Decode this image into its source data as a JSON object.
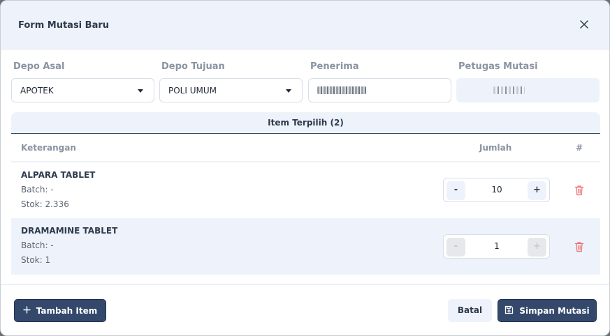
{
  "modal": {
    "title": "Form Mutasi Baru"
  },
  "fields": {
    "depo_asal": {
      "label": "Depo Asal",
      "value": "APOTEK"
    },
    "depo_tujuan": {
      "label": "Depo Tujuan",
      "value": "POLI UMUM"
    },
    "penerima": {
      "label": "Penerima"
    },
    "petugas": {
      "label": "Petugas Mutasi"
    }
  },
  "items": {
    "header": "Item Terpilih (2)",
    "columns": {
      "keterangan": "Keterangan",
      "jumlah": "Jumlah",
      "aksi": "#"
    },
    "rows": [
      {
        "name": "ALPARA TABLET",
        "batch": "Batch: -",
        "stok": "Stok: 2.336",
        "qty": "10"
      },
      {
        "name": "DRAMAMINE TABLET",
        "batch": "Batch: -",
        "stok": "Stok: 1",
        "qty": "1"
      }
    ],
    "minus": "-",
    "plus": "+"
  },
  "footer": {
    "add_label": "Tambah Item",
    "cancel_label": "Batal",
    "save_label": "Simpan Mutasi"
  },
  "colors": {
    "primary": "#34486b",
    "header_bg": "#eef3fb",
    "danger": "#ef6b6b"
  },
  "icons": {
    "close": "close-icon",
    "add": "plus-icon",
    "save": "save-icon",
    "delete": "trash-icon",
    "dropdown": "caret-down-icon"
  }
}
